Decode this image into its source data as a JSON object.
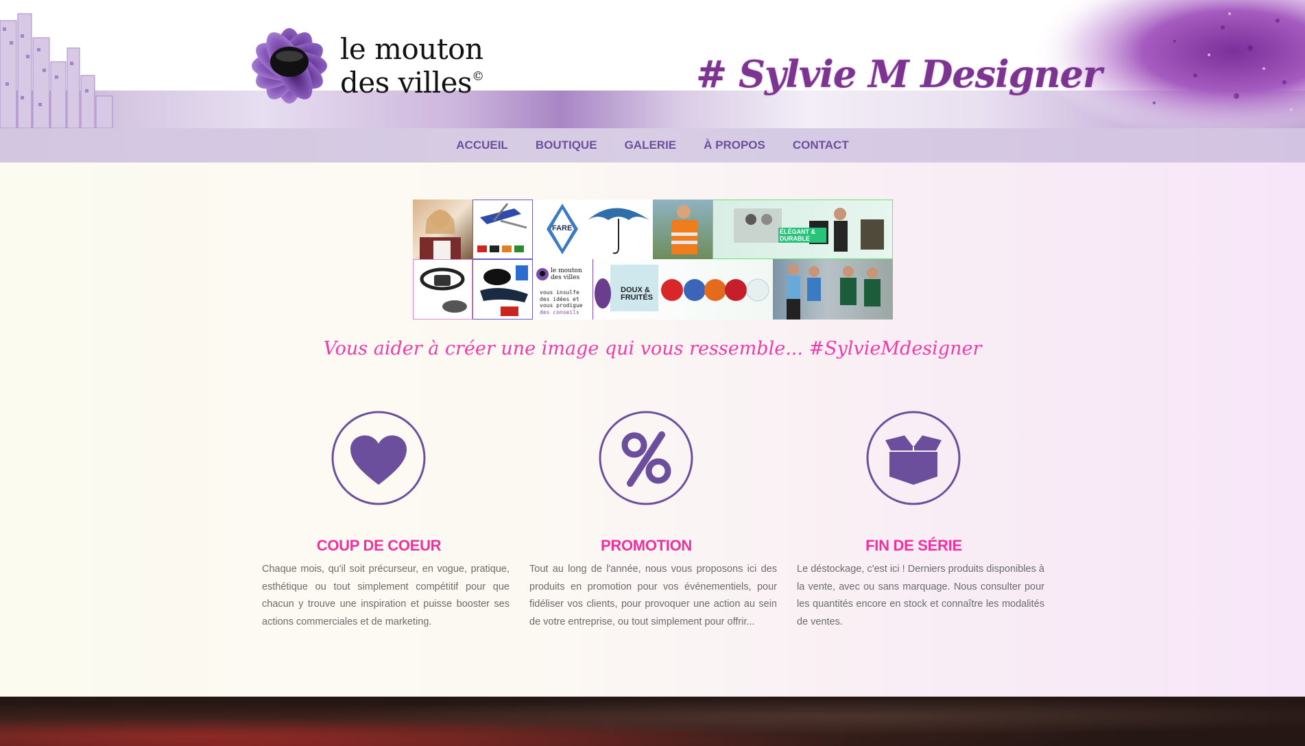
{
  "header": {
    "logo_line1": "le mouton",
    "logo_line2": "des villes",
    "logo_mark": "©",
    "signature": "# Sylvie M Designer"
  },
  "nav": {
    "items": [
      {
        "label": "ACCUEIL"
      },
      {
        "label": "BOUTIQUE"
      },
      {
        "label": "GALERIE"
      },
      {
        "label": "À PROPOS"
      },
      {
        "label": "CONTACT"
      }
    ]
  },
  "mosaic": {
    "tiles": [
      {
        "name": "photo-woman-towel"
      },
      {
        "name": "photo-multitool"
      },
      {
        "name": "photo-fare-umbrella",
        "text": "FARE"
      },
      {
        "name": "photo-safety-vest"
      },
      {
        "name": "photo-bags",
        "text": "ÉLÉGANT & DURABLE"
      },
      {
        "name": "photo-headlamp"
      },
      {
        "name": "photo-sunglasses"
      },
      {
        "name": "photo-logo-advice",
        "text_line1": "le mouton",
        "text_line2": "des villes",
        "text_line3": "vous insulfe",
        "text_line4": "des idées et",
        "text_line5": "vous prodigue",
        "text_line6": "des conseils"
      },
      {
        "name": "photo-plush-fruits",
        "text": "DOUX & FRUITÉS"
      },
      {
        "name": "photo-tshirts"
      }
    ]
  },
  "tagline": "Vous aider à créer une image qui vous ressemble... #SylvieMdesigner",
  "features": [
    {
      "icon": "heart-icon",
      "title": "COUP DE COEUR",
      "text": "Chaque mois, qu'il soit précurseur, en vogue, pratique, esthétique ou tout simplement compétitif pour que chacun y trouve une inspiration et puisse booster ses actions commerciales et de marketing."
    },
    {
      "icon": "percent-icon",
      "title": "PROMOTION",
      "text": "Tout au long de l'année, nous vous proposons ici des produits en promotion pour vos événementiels, pour fidéliser vos clients, pour provoquer une action au sein de votre entreprise, ou tout simplement pour offrir..."
    },
    {
      "icon": "box-icon",
      "title": "FIN DE SÉRIE",
      "text": "Le déstockage, c'est ici ! Derniers produits disponibles à la vente, avec ou sans marquage. Nous consulter pour les quantités encore en stock et connaître les modalités de ventes."
    }
  ],
  "colors": {
    "accent_purple": "#6c4f9c",
    "accent_pink": "#f0309f",
    "nav_bg": "#d5c9e3"
  }
}
